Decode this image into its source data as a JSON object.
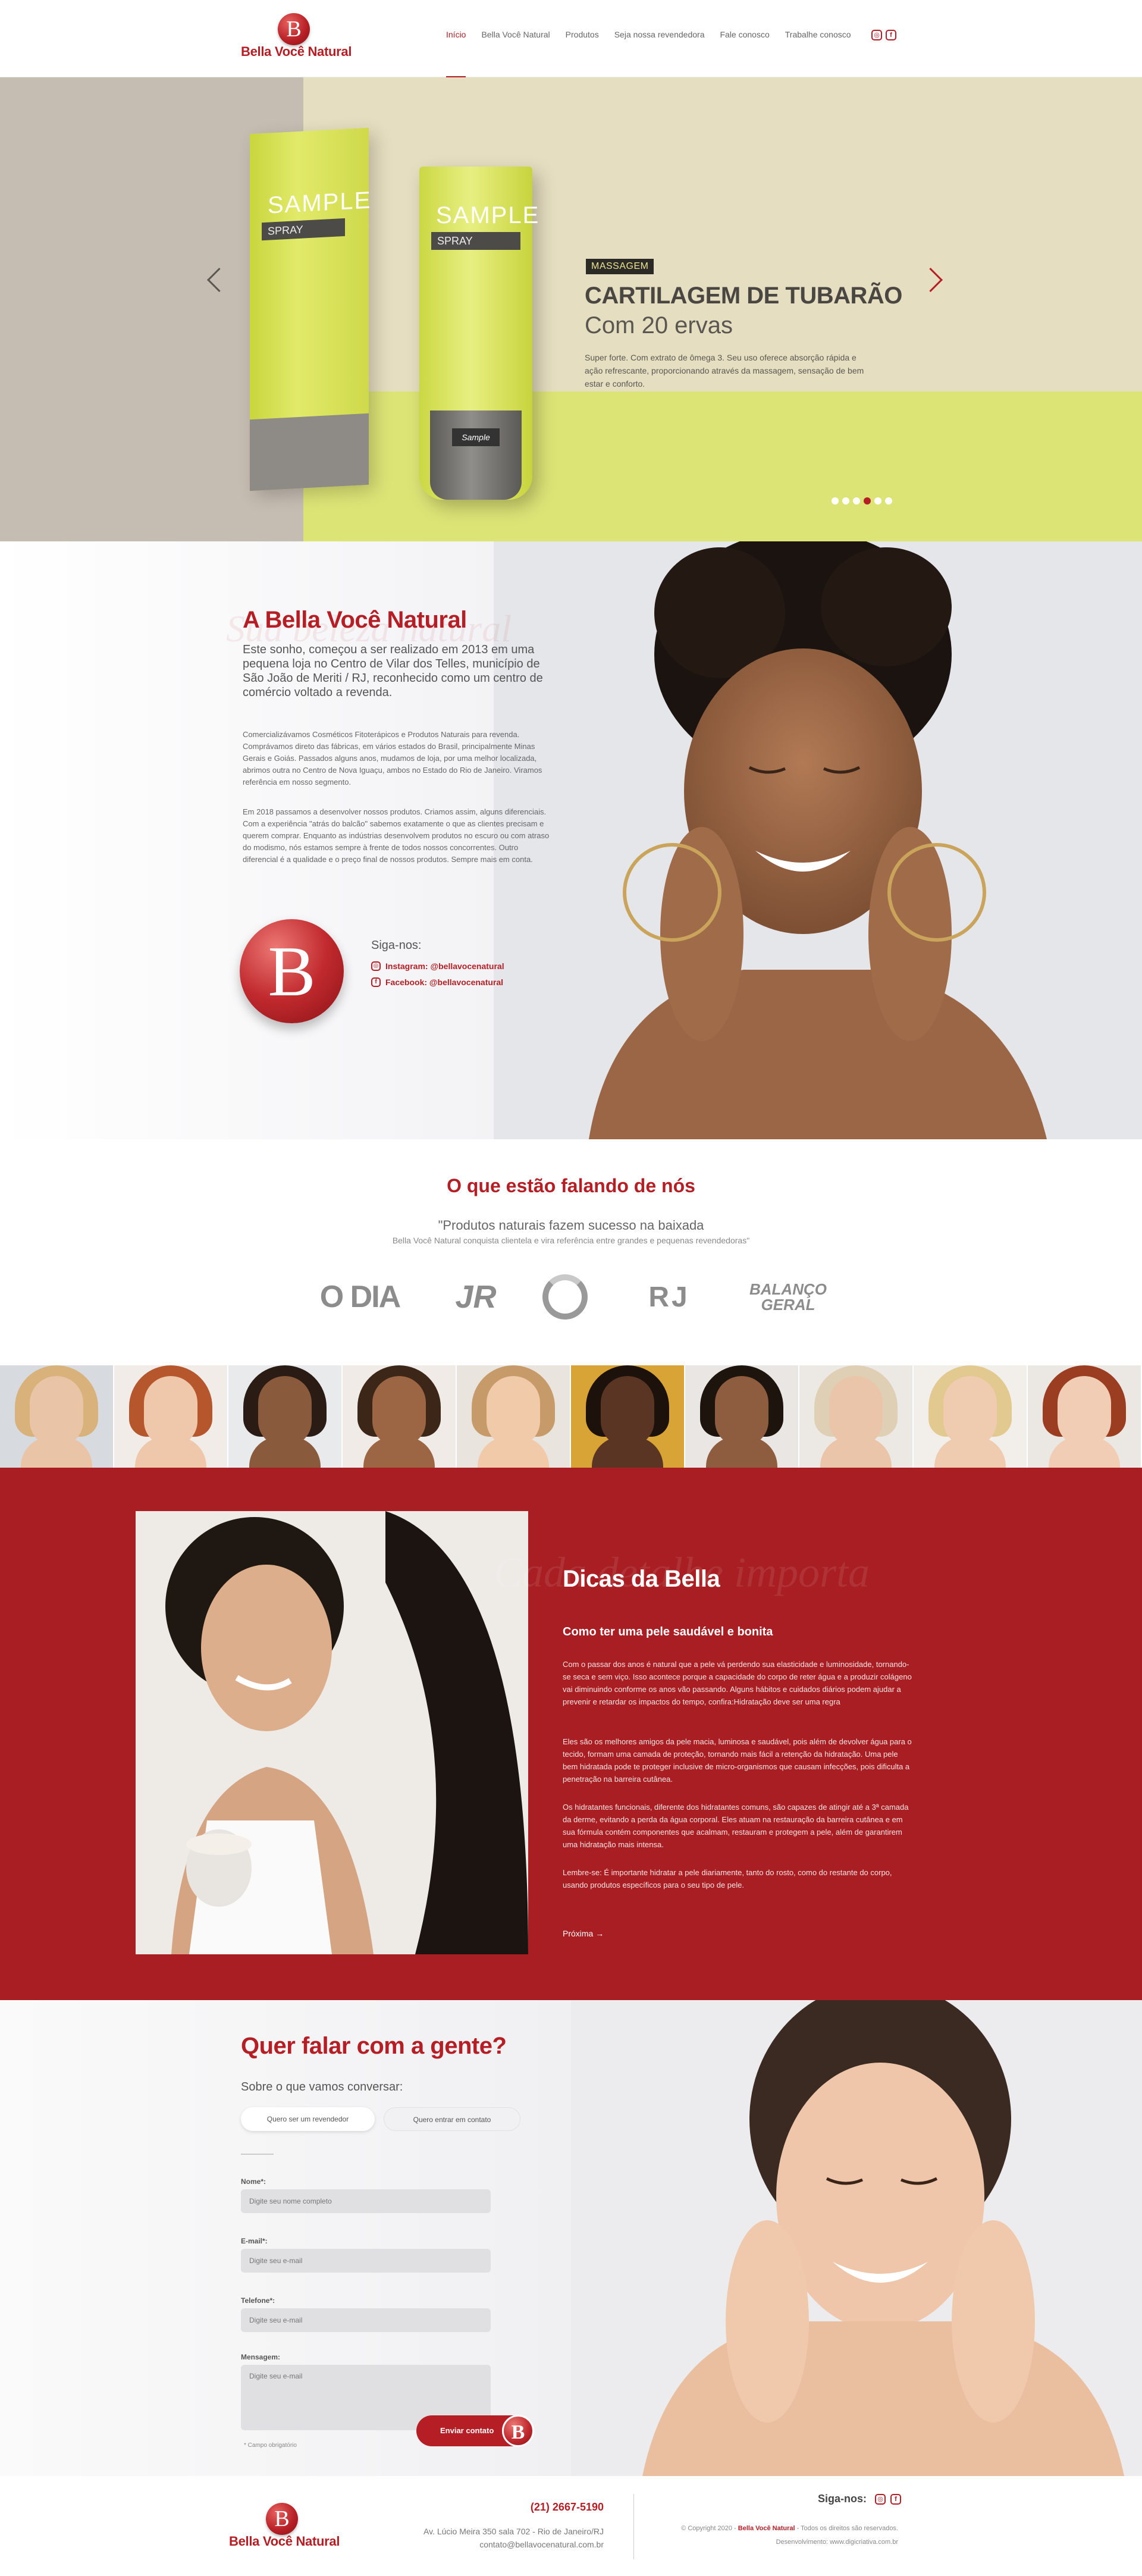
{
  "brand": {
    "name": "Bella Você Natural",
    "monogram": "B"
  },
  "nav": {
    "items": [
      {
        "label": "Início",
        "active": true
      },
      {
        "label": "Bella Você Natural",
        "active": false
      },
      {
        "label": "Produtos",
        "active": false
      },
      {
        "label": "Seja nossa revendedora",
        "active": false
      },
      {
        "label": "Fale conosco",
        "active": false
      },
      {
        "label": "Trabalhe conosco",
        "active": false
      }
    ],
    "social_icons": [
      "instagram-icon",
      "facebook-icon"
    ]
  },
  "hero": {
    "tag": "MASSAGEM",
    "title": "CARTILAGEM DE TUBARÃO",
    "subtitle": "Com 20 ervas",
    "description": "Super forte. Com extrato de ômega 3. Seu uso oferece absorção rápida e ação refrescante, proporcionando através da massagem, sensação de bem estar e conforto.",
    "product_box_label": "SAMPLE",
    "product_box_band": "SPRAY",
    "tube_label": "SAMPLE",
    "tube_band": "SPRAY",
    "tube_brand": "Sample",
    "slide_count": 6,
    "active_slide": 4,
    "colors": {
      "left_bg": "#c6bdb2",
      "main_bg": "#e6dec0",
      "band": "#dde476",
      "accent": "#b51e24"
    }
  },
  "about": {
    "title": "A Bella Você Natural",
    "script_watermark": "Sua beleza natural",
    "lead": "Este sonho, começou a ser realizado em 2013 em uma pequena loja no Centro de Vilar dos Telles, município de São João de Meriti / RJ, reconhecido como um centro de comércio voltado a revenda.",
    "paragraph_1": "Comercializávamos Cosméticos Fitoterápicos e Produtos Naturais para revenda. Comprávamos direto das fábricas, em vários estados do Brasil, principalmente Minas Gerais e Goiás. Passados alguns anos, mudamos de loja, por uma melhor localizada, abrimos outra no Centro de Nova Iguaçu, ambos no Estado do Rio de Janeiro. Viramos referência em nosso segmento.",
    "paragraph_2": "Em 2018 passamos a desenvolver nossos produtos. Criamos assim, alguns diferenciais. Com a experiência \"atrás do balcão\" sabemos exatamente o que as clientes precisam e querem comprar. Enquanto as indústrias desenvolvem produtos no escuro ou com atraso do modismo, nós estamos sempre à frente de todos nossos concorrentes. Outro diferencial é a qualidade e o preço final de nossos produtos. Sempre mais em conta.",
    "follow_label": "Siga-nos:",
    "instagram": "Instagram: @bellavocenatural",
    "facebook": "Facebook: @bellavocenatural"
  },
  "press": {
    "title": "O que estão falando de nós",
    "quote": "\"Produtos naturais fazem sucesso na baixada",
    "sub": "Bella Você Natural conquista clientela e vira referência entre grandes e pequenas revendedoras\"",
    "logos": [
      "O DIA",
      "JR",
      "Globo",
      "RJ",
      "BALANÇO GERAL"
    ]
  },
  "faces": [
    {
      "bg": "#d7dade",
      "skin": "#e9c4a6",
      "hair": "#d8b27a"
    },
    {
      "bg": "#f1ece8",
      "skin": "#efc7aa",
      "hair": "#b5562c"
    },
    {
      "bg": "#e9eaec",
      "skin": "#8a5a3d",
      "hair": "#2a1c14"
    },
    {
      "bg": "#f0ebe7",
      "skin": "#9c6644",
      "hair": "#3c2618"
    },
    {
      "bg": "#eae4df",
      "skin": "#f0caa9",
      "hair": "#c79b69"
    },
    {
      "bg": "#d8a436",
      "skin": "#5a3523",
      "hair": "#1d120b"
    },
    {
      "bg": "#e9e6e3",
      "skin": "#8e5d40",
      "hair": "#1e140e"
    },
    {
      "bg": "#ece8e4",
      "skin": "#eac5aa",
      "hair": "#dfcfb5"
    },
    {
      "bg": "#f2eeea",
      "skin": "#efcbb0",
      "hair": "#e2c98f"
    },
    {
      "bg": "#ebe7e3",
      "skin": "#f1cdb5",
      "hair": "#9a3d21"
    }
  ],
  "tips": {
    "script_watermark": "Cada detalhe importa",
    "title": "Dicas da Bella",
    "subtitle": "Como ter uma pele saudável e bonita",
    "paragraph_1": "Com o passar dos anos é natural que a pele vá perdendo sua elasticidade e luminosidade, tornando-se seca e sem viço. Isso acontece porque a capacidade do corpo de reter água e a produzir colágeno vai diminuindo conforme os anos vão passando. Alguns hábitos e cuidados diários podem ajudar a prevenir e retardar os impactos do tempo, confira:Hidratação deve ser uma regra",
    "paragraph_2": "Eles são os melhores amigos da pele macia, luminosa e saudável, pois além de devolver água para o tecido, formam uma camada de proteção, tornando mais fácil a retenção da hidratação. Uma pele bem hidratada pode te proteger inclusive de micro-organismos que causam infecções, pois dificulta a penetração na barreira cutânea.",
    "paragraph_3": "Os hidratantes funcionais, diferente dos hidratantes comuns, são capazes de atingir até a 3ª camada da derme, evitando a perda da água corporal. Eles atuam na restauração da barreira cutânea e em sua fórmula contém componentes que acalmam, restauram e protegem a pele, além de garantirem uma hidratação mais intensa.",
    "paragraph_4": "Lembre-se: É importante hidratar a pele diariamente, tanto do rosto, como do restante do corpo, usando produtos específicos para o seu tipo de pele.",
    "next_label": "Próxima"
  },
  "contact": {
    "title": "Quer falar com a gente?",
    "question": "Sobre o que vamos conversar:",
    "options": [
      "Quero ser um revendedor",
      "Quero entrar em contato"
    ],
    "fields": {
      "name": {
        "label": "Nome*:",
        "placeholder": "Digite seu nome completo"
      },
      "email": {
        "label": "E-mail*:",
        "placeholder": "Digite seu e-mail"
      },
      "phone": {
        "label": "Telefone*:",
        "placeholder": "Digite seu e-mail"
      },
      "message": {
        "label": "Mensagem:",
        "placeholder": "Digite seu e-mail"
      }
    },
    "required_note": "* Campo obrigatório",
    "submit_label": "Enviar contato"
  },
  "footer": {
    "phone": "(21) 2667-5190",
    "address": "Av. Lúcio Meira 350 sala 702 - Rio de Janeiro/RJ",
    "email": "contato@bellavocenatural.com.br",
    "follow_label": "Siga-nos:",
    "copyright_prefix": "© Copyright 2020 -",
    "copyright_brand": "Bella Você Natural",
    "copyright_suffix": "- Todos os direitos são reservados.",
    "developer": "Desenvolvimento: www.digicriativa.com.br"
  }
}
